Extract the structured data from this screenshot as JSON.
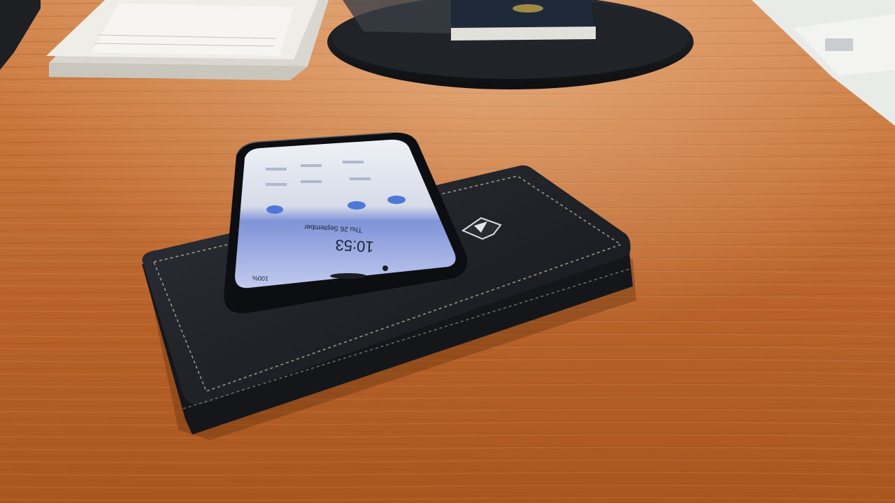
{
  "scene": {
    "description_free": true,
    "colors": {
      "desk_light": "#cf7a3e",
      "desk_mid": "#b8622a",
      "desk_dark": "#8f4418",
      "wallet": "#23252b",
      "wallet_stitch": "#c9b8a4",
      "phone_body": "#0e0f12",
      "phone_screen": "#b9c4e6",
      "paper": "#eceae4",
      "tray": "#17191c"
    }
  },
  "phone_screen": {
    "time": "10:53",
    "date": "Thu 26 September",
    "battery": "100%"
  }
}
